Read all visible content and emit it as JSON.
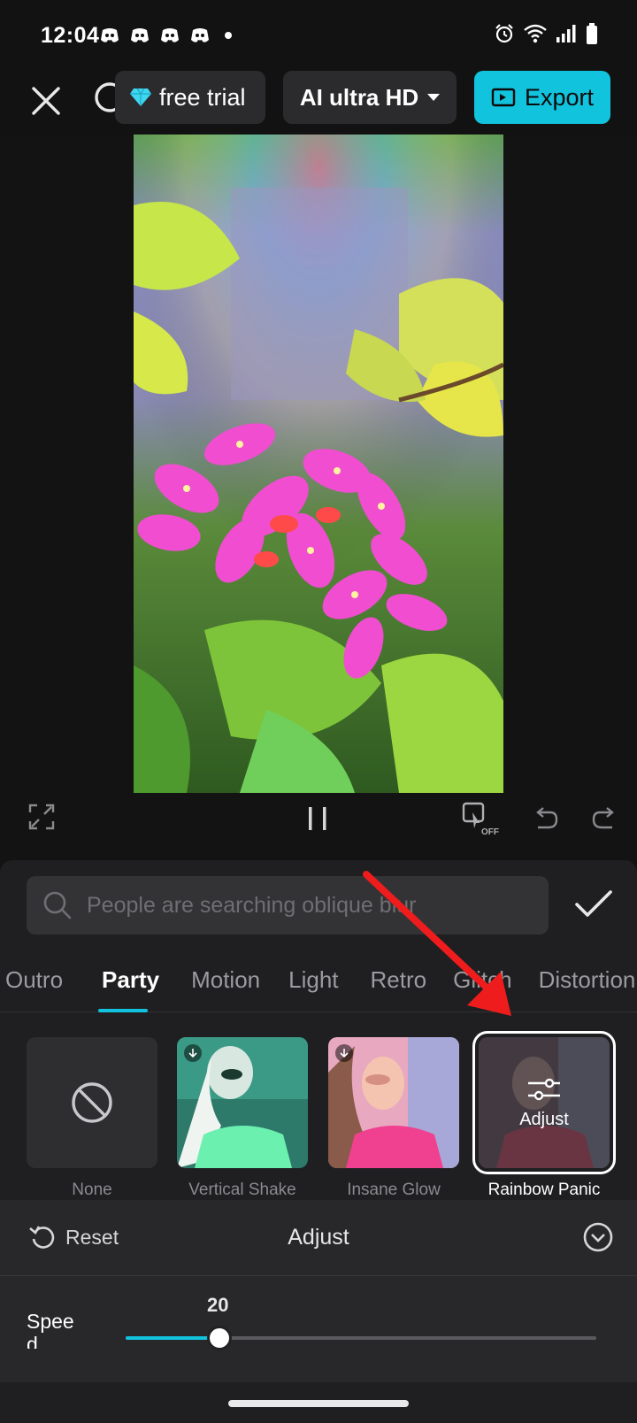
{
  "status_bar": {
    "time": "12:04",
    "notification_icons": [
      "discord-icon",
      "discord-icon",
      "discord-icon",
      "discord-icon"
    ],
    "right_icons": [
      "alarm-icon",
      "wifi-icon",
      "signal-icon",
      "battery-icon"
    ]
  },
  "toolbar": {
    "trial_label": "free trial",
    "hd_label": "AI ultra HD",
    "export_label": "Export",
    "accent_color": "#12c3dd"
  },
  "panel": {
    "search_placeholder": "People are searching oblique blur",
    "tabs": [
      "Outro",
      "Party",
      "Motion",
      "Light",
      "Retro",
      "Glitch",
      "Distortion"
    ],
    "active_tab": "Party",
    "effects": [
      {
        "label": "None"
      },
      {
        "label": "Vertical Shake"
      },
      {
        "label": "Insane Glow"
      },
      {
        "label": "Rainbow Panic",
        "overlay_label": "Adjust",
        "selected": true
      }
    ],
    "adjust": {
      "reset_label": "Reset",
      "title": "Adjust",
      "speed_label": "Speed",
      "speed_value": "20",
      "speed_fraction": 0.2
    }
  }
}
